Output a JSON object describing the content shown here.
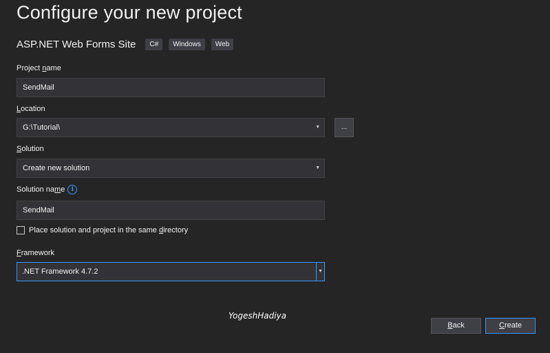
{
  "header": {
    "title": "Configure your new project",
    "template_name": "ASP.NET Web Forms Site",
    "tags": [
      "C#",
      "Windows",
      "Web"
    ]
  },
  "form": {
    "project_name": {
      "label_pre": "Project ",
      "label_accel": "n",
      "label_post": "ame",
      "value": "SendMail"
    },
    "location": {
      "label_pre": "",
      "label_accel": "L",
      "label_post": "ocation",
      "value": "G:\\Tutorial\\",
      "browse_label": "..."
    },
    "solution": {
      "label_pre": "",
      "label_accel": "S",
      "label_post": "olution",
      "value": "Create new solution"
    },
    "solution_name": {
      "label_pre": "Solution na",
      "label_accel": "m",
      "label_post": "e",
      "value": "SendMail",
      "info_icon": "info-icon"
    },
    "same_directory": {
      "label_pre": "Place solution and project in the same ",
      "label_accel": "d",
      "label_post": "irectory",
      "checked": false
    },
    "framework": {
      "label_pre": "",
      "label_accel": "F",
      "label_post": "ramework",
      "value": ".NET Framework 4.7.2"
    }
  },
  "watermark": "YogeshHadiya",
  "buttons": {
    "back_accel": "B",
    "back_post": "ack",
    "create_accel": "C",
    "create_post": "reate"
  },
  "colors": {
    "background": "#252526",
    "field_bg": "#333337",
    "accent": "#3399ff"
  }
}
